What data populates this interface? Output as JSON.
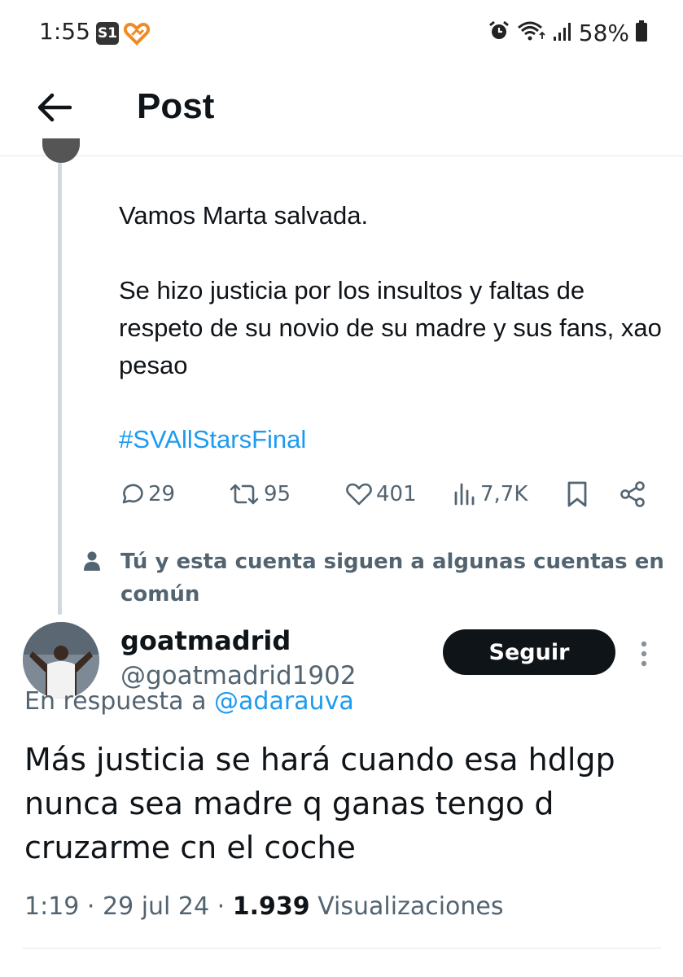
{
  "status_bar": {
    "time": "1:55",
    "app_icon_1": "S1",
    "battery": "58%"
  },
  "header": {
    "title": "Post"
  },
  "parent_tweet": {
    "lines": [
      "Vamos Marta salvada.",
      "Se hizo justicia por los insultos y faltas de respeto de su novio de su madre y sus fans, xao pesao"
    ],
    "hashtag": "#SVAllStarsFinal",
    "stats": {
      "replies": "29",
      "reposts": "95",
      "likes": "401",
      "views": "7,7K"
    },
    "social_context": "Tú y esta cuenta siguen a algunas cuentas en común"
  },
  "reply": {
    "author_name": "goatmadrid",
    "author_handle": "@goatmadrid1902",
    "follow_label": "Seguir",
    "reply_to_prefix": "En respuesta a",
    "reply_to_handle": "@adarauva",
    "text": "Más justicia se hará cuando esa hdlgp nunca sea madre q ganas tengo d cruzarme cn el coche",
    "time": "1:19",
    "date": "29 jul 24",
    "views_count": "1.939",
    "views_label": "Visualizaciones"
  },
  "icons": {
    "back": "arrow-left-icon",
    "reply": "speech-bubble-icon",
    "repost": "repost-icon",
    "like": "heart-icon",
    "views": "bar-chart-icon",
    "bookmark": "bookmark-icon",
    "share": "share-icon",
    "more": "vertical-dots-icon",
    "person": "person-icon"
  },
  "colors": {
    "accent": "#1d9bf0",
    "text": "#0f1419",
    "secondary": "#536471",
    "follow_bg": "#0f1419"
  }
}
